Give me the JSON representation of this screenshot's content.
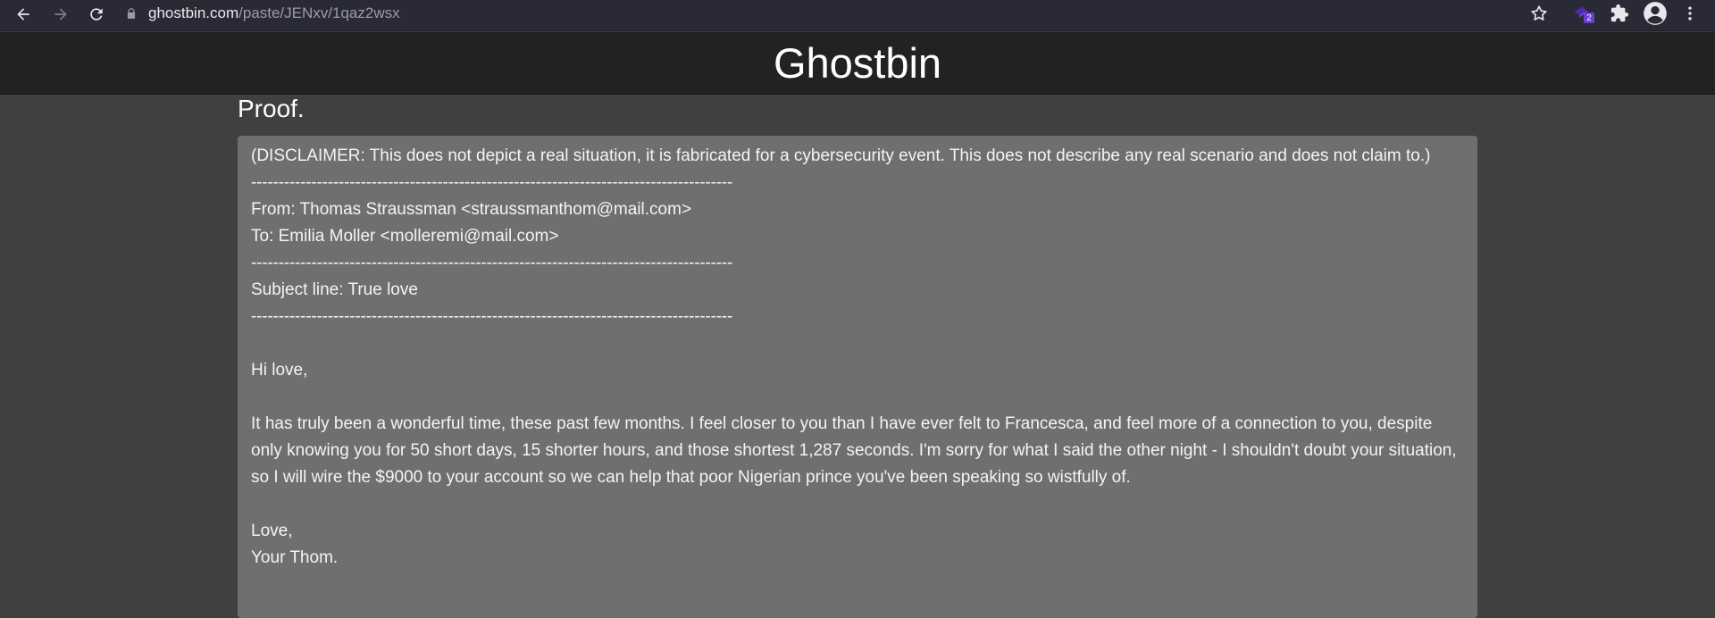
{
  "browser": {
    "url_host": "ghostbin.com",
    "url_path": "/paste/JENxv/1qaz2wsx",
    "extension_badge": "2",
    "icons": [
      "back-arrow-icon",
      "forward-arrow-icon",
      "reload-icon",
      "lock-icon",
      "star-icon",
      "extension-icon",
      "puzzle-icon",
      "profile-icon",
      "kebab-menu-icon"
    ]
  },
  "header": {
    "site_title": "Ghostbin"
  },
  "paste": {
    "title": "Proof.",
    "lines": [
      "(DISCLAIMER: This does not depict a real situation, it is fabricated for a cybersecurity event. This does not describe any real scenario and does not claim to.)",
      "----------------------------------------------------------------------------------------",
      "From: Thomas Straussman <straussmanthom@mail.com>",
      "To: Emilia Moller <molleremi@mail.com>",
      "----------------------------------------------------------------------------------------",
      "Subject line: True love",
      "----------------------------------------------------------------------------------------",
      "",
      "Hi love,",
      "",
      "It has truly been a wonderful time, these past few months. I feel closer to you than I have ever felt to Francesca, and feel more of a connection to you, despite only knowing you for 50 short days, 15 shorter hours, and those shortest 1,287 seconds. I'm sorry for what I said the other night - I shouldn't doubt your situation, so I will wire the $9000 to your account so we can help that poor Nigerian prince you've been speaking so wistfully of.",
      "",
      "Love,",
      "Your Thom."
    ]
  },
  "colors": {
    "chrome_bg": "#292a35",
    "header_bg": "#222222",
    "page_bg": "#404040",
    "paste_bg": "#6f6f6f",
    "badge": "#6b3fd6"
  }
}
